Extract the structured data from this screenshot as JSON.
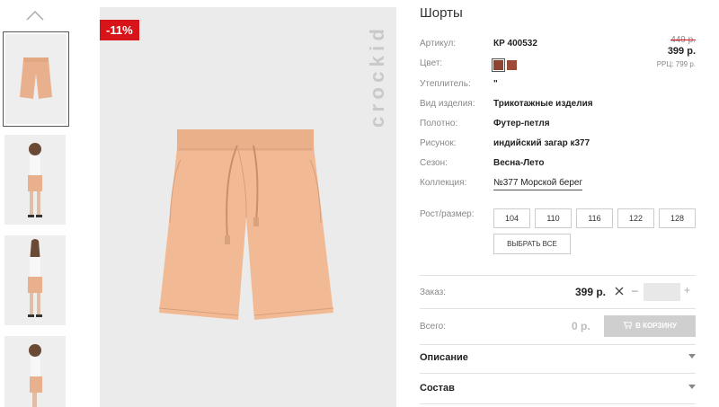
{
  "badge": "-11%",
  "brand": "crockid",
  "product": {
    "title": "Шорты",
    "price_old": "449 р.",
    "price_new": "399 р.",
    "rrp": "РРЦ: 799 р."
  },
  "specs": [
    {
      "label": "Артикул:",
      "value": "КР 400532"
    },
    {
      "label": "Цвет:",
      "value": ""
    },
    {
      "label": "Утеплитель:",
      "value": "\""
    },
    {
      "label": "Вид изделия:",
      "value": "Трикотажные изделия"
    },
    {
      "label": "Полотно:",
      "value": "Футер-петля"
    },
    {
      "label": "Рисунок:",
      "value": "индийский загар к377"
    },
    {
      "label": "Сезон:",
      "value": "Весна-Лето"
    },
    {
      "label": "Коллекция:",
      "value": "№377 Морской берег"
    }
  ],
  "colors": [
    "#8d4330",
    "#9b4b38"
  ],
  "sizes_label": "Рост/размер:",
  "sizes": [
    "104",
    "110",
    "116",
    "122",
    "128"
  ],
  "select_all": "ВЫБРАТЬ ВСЕ",
  "order": {
    "label": "Заказ:",
    "price": "399 р.",
    "minus": "–",
    "plus": "+",
    "quantity": ""
  },
  "total": {
    "label": "Всего:",
    "value": "0 р.",
    "cart_button": "В КОРЗИНУ"
  },
  "accordion": [
    {
      "label": "Описание"
    },
    {
      "label": "Состав"
    }
  ],
  "accent_color": "#d7141a"
}
